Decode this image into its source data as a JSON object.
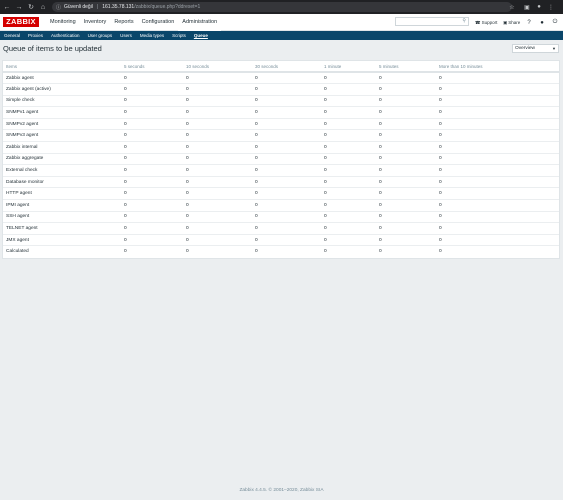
{
  "browser": {
    "security_label": "Güvenli değil",
    "url_host": "161.35.78.131",
    "url_path": "/zabbix/queue.php?ddreset=1",
    "back_icon": "back-arrow-icon",
    "forward_icon": "forward-arrow-icon",
    "reload_icon": "reload-icon",
    "home_icon": "home-icon"
  },
  "logo": "ZABBIX",
  "topmenu": [
    "Monitoring",
    "Inventory",
    "Reports",
    "Configuration",
    "Administration"
  ],
  "header_links": {
    "support": "Support",
    "share": "Share",
    "help": "?"
  },
  "submenu": [
    "General",
    "Proxies",
    "Authentication",
    "User groups",
    "Users",
    "Media types",
    "Scripts",
    "Queue"
  ],
  "page_title": "Queue of items to be updated",
  "view_select": "Overview",
  "table": {
    "headers": [
      "Items",
      "5 seconds",
      "10 seconds",
      "30 seconds",
      "1 minute",
      "5 minutes",
      "More than 10 minutes"
    ],
    "rows": [
      [
        "Zabbix agent",
        "0",
        "0",
        "0",
        "0",
        "0",
        "0"
      ],
      [
        "Zabbix agent (active)",
        "0",
        "0",
        "0",
        "0",
        "0",
        "0"
      ],
      [
        "Simple check",
        "0",
        "0",
        "0",
        "0",
        "0",
        "0"
      ],
      [
        "SNMPv1 agent",
        "0",
        "0",
        "0",
        "0",
        "0",
        "0"
      ],
      [
        "SNMPv2 agent",
        "0",
        "0",
        "0",
        "0",
        "0",
        "0"
      ],
      [
        "SNMPv3 agent",
        "0",
        "0",
        "0",
        "0",
        "0",
        "0"
      ],
      [
        "Zabbix internal",
        "0",
        "0",
        "0",
        "0",
        "0",
        "0"
      ],
      [
        "Zabbix aggregate",
        "0",
        "0",
        "0",
        "0",
        "0",
        "0"
      ],
      [
        "External check",
        "0",
        "0",
        "0",
        "0",
        "0",
        "0"
      ],
      [
        "Database monitor",
        "0",
        "0",
        "0",
        "0",
        "0",
        "0"
      ],
      [
        "HTTP agent",
        "0",
        "0",
        "0",
        "0",
        "0",
        "0"
      ],
      [
        "IPMI agent",
        "0",
        "0",
        "0",
        "0",
        "0",
        "0"
      ],
      [
        "SSH agent",
        "0",
        "0",
        "0",
        "0",
        "0",
        "0"
      ],
      [
        "TELNET agent",
        "0",
        "0",
        "0",
        "0",
        "0",
        "0"
      ],
      [
        "JMX agent",
        "0",
        "0",
        "0",
        "0",
        "0",
        "0"
      ],
      [
        "Calculated",
        "0",
        "0",
        "0",
        "0",
        "0",
        "0"
      ]
    ]
  },
  "footer": "Zabbix 4.4.5. © 2001–2020, Zabbix SIA",
  "colors": {
    "brand_red": "#d40000",
    "submenu_bg": "#0a466a",
    "page_bg": "#ebeef0"
  }
}
